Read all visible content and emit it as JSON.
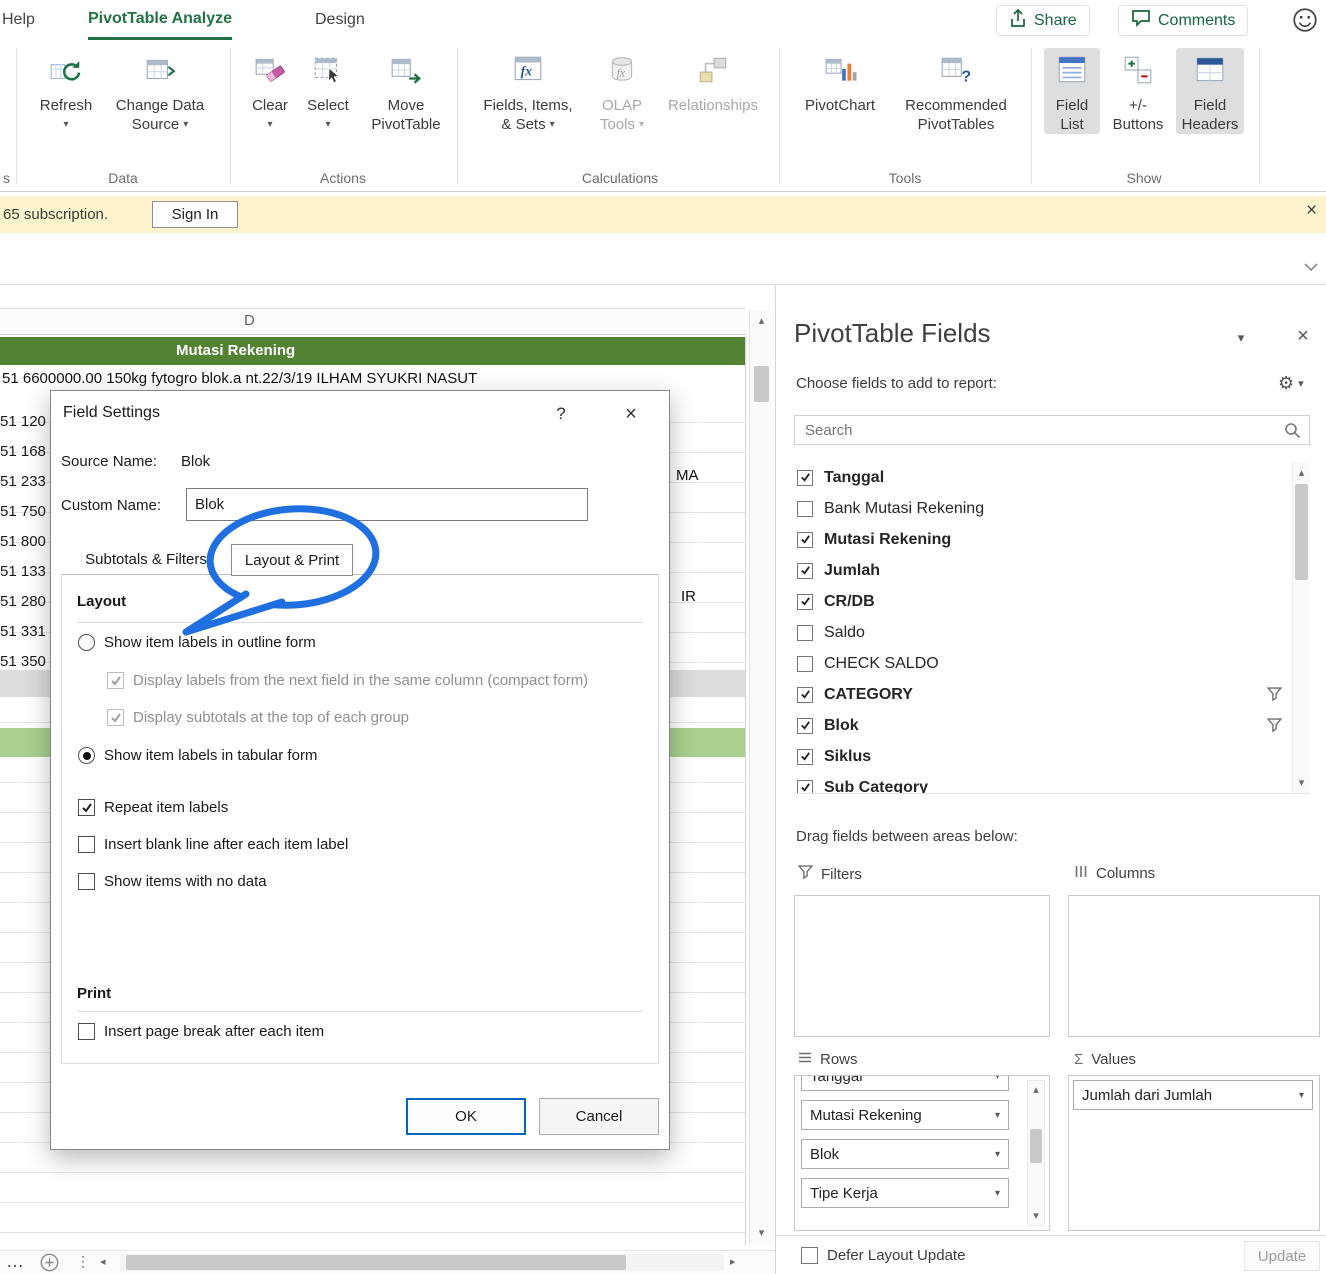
{
  "icons": {
    "dropdown": "▾",
    "up": "▴",
    "down": "▾",
    "left": "◂",
    "right": "▸",
    "close": "×",
    "help": "?",
    "gear": "⚙",
    "sigma": "Σ",
    "ellipsis": "…",
    "vdots": "⋮"
  },
  "ribbon": {
    "tabs": {
      "help": "Help",
      "analyze": "PivotTable Analyze",
      "design": "Design"
    },
    "share": "Share",
    "comments": "Comments",
    "left_fragment": "s",
    "data": {
      "label": "Data",
      "refresh": "Refresh",
      "cds1": "Change Data",
      "cds2": "Source"
    },
    "actions": {
      "label": "Actions",
      "clear": "Clear",
      "select": "Select",
      "move1": "Move",
      "move2": "PivotTable"
    },
    "calc": {
      "label": "Calculations",
      "fis1": "Fields, Items,",
      "fis2": "& Sets",
      "olap1": "OLAP",
      "olap2": "Tools",
      "rel": "Relationships"
    },
    "tools": {
      "label": "Tools",
      "pivotchart": "PivotChart",
      "rec1": "Recommended",
      "rec2": "PivotTables"
    },
    "show": {
      "label": "Show",
      "fl1": "Field",
      "fl2": "List",
      "pm1": "+/-",
      "pm2": "Buttons",
      "fh1": "Field",
      "fh2": "Headers"
    }
  },
  "notice": {
    "text": "65 subscription.",
    "sign_in": "Sign In"
  },
  "sheet": {
    "col": "D",
    "header": "Mutasi Rekening",
    "row1": "51 6600000.00  150kg fytogro blok.a nt.22/3/19  ILHAM SYUKRI NASUT",
    "frags": [
      "51 120",
      "51 168",
      "51 233",
      "51 750",
      "51 800",
      "51 133",
      "51 280",
      "51 331",
      "51 350"
    ],
    "frag_ma": "MA",
    "frag_ir": "IR"
  },
  "dialog": {
    "title": "Field Settings",
    "source_name_label": "Source Name:",
    "source_name_value": "Blok",
    "custom_name_label": "Custom Name:",
    "custom_name_value": "Blok",
    "tab_subtotals": "Subtotals & Filters",
    "tab_layout": "Layout & Print",
    "layout_heading": "Layout",
    "opt_outline": "Show item labels in outline form",
    "opt_compact": "Display labels from the next field in the same column (compact form)",
    "opt_subtotals_top": "Display subtotals at the top of each group",
    "opt_tabular": "Show item labels in tabular form",
    "opt_repeat": "Repeat item labels",
    "opt_blank_line": "Insert blank line after each item label",
    "opt_no_data": "Show items with no data",
    "print_heading": "Print",
    "opt_page_break": "Insert page break after each item",
    "layout_options": {
      "outline_selected": false,
      "tabular_selected": true,
      "compact_checked": true,
      "compact_disabled": true,
      "subtotals_top_checked": true,
      "subtotals_top_disabled": true,
      "repeat_checked": true,
      "blank_line_checked": false,
      "no_data_checked": false,
      "page_break_checked": false
    },
    "ok": "OK",
    "cancel": "Cancel"
  },
  "pane": {
    "title": "PivotTable Fields",
    "choose": "Choose fields to add to report:",
    "search_placeholder": "Search",
    "fields": [
      {
        "label": "Tanggal",
        "checked": true
      },
      {
        "label": "Bank Mutasi Rekening",
        "checked": false
      },
      {
        "label": "Mutasi Rekening",
        "checked": true
      },
      {
        "label": "Jumlah",
        "checked": true
      },
      {
        "label": "CR/DB",
        "checked": true
      },
      {
        "label": "Saldo",
        "checked": false
      },
      {
        "label": "CHECK SALDO",
        "checked": false
      },
      {
        "label": "CATEGORY",
        "checked": true,
        "filter": true
      },
      {
        "label": "Blok",
        "checked": true,
        "filter": true
      },
      {
        "label": "Siklus",
        "checked": true
      },
      {
        "label": "Sub Category",
        "checked": true
      }
    ],
    "drag": "Drag fields between areas below:",
    "filters_label": "Filters",
    "columns_label": "Columns",
    "rows_label": "Rows",
    "values_label": "Values",
    "rows_items": [
      "Tanggal",
      "Mutasi Rekening",
      "Blok",
      "Tipe Kerja"
    ],
    "values_items": [
      "Jumlah dari Jumlah"
    ],
    "defer": "Defer Layout Update",
    "defer_checked": false,
    "update": "Update",
    "update_enabled": false
  }
}
